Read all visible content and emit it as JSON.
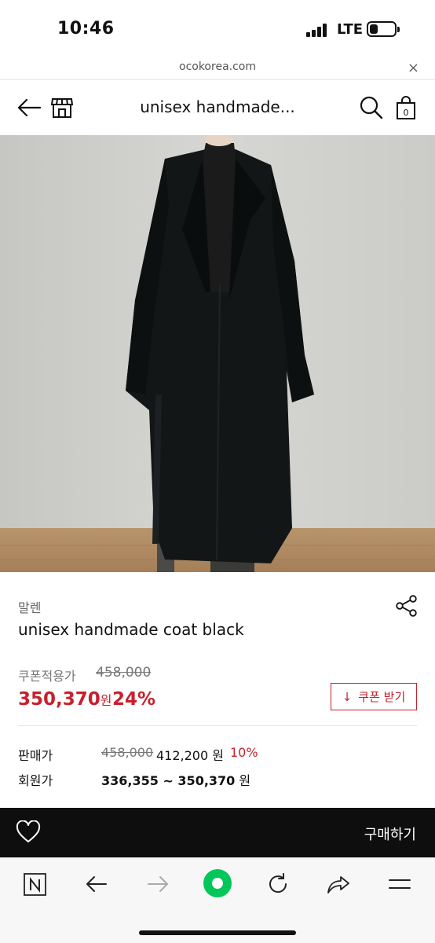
{
  "status": {
    "time": "10:46",
    "network": "LTE"
  },
  "browser": {
    "url": "ocokorea.com",
    "close_glyph": "×"
  },
  "header": {
    "title": "unisex handmade..."
  },
  "product": {
    "brand": "말렌",
    "name": "unisex handmade coat black",
    "coupon_price_label": "쿠폰적용가",
    "original_price": "458,000",
    "sale_price": "350,370",
    "currency": "원",
    "discount": "24%",
    "coupon_button": "쿠폰 받기",
    "coupon_button_icon": "↓",
    "selling_price_label": "판매가",
    "selling_original": "458,000",
    "selling_price": "412,200 원",
    "selling_rate": "10%",
    "member_price_label": "회원가",
    "member_price": "336,355 ~ 350,370",
    "member_currency": " 원"
  },
  "buy_bar": {
    "buy_label": "구매하기"
  },
  "colors": {
    "accent": "#c8202c",
    "buy_bar_bg": "#0e0e0e",
    "naver_green": "#03c75a"
  }
}
